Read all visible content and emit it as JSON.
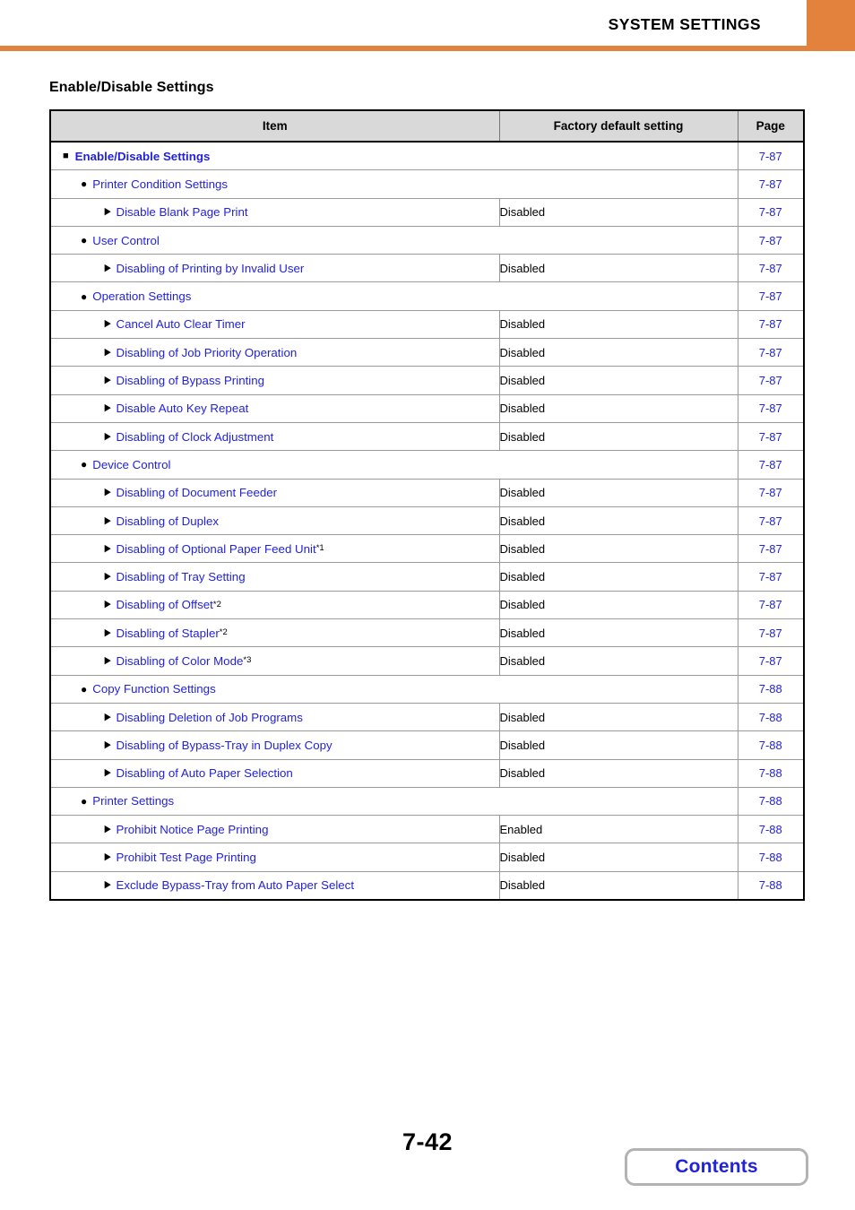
{
  "header": {
    "title": "SYSTEM SETTINGS",
    "accent_color": "#e2823c"
  },
  "section": {
    "title": "Enable/Disable Settings"
  },
  "table": {
    "columns": [
      "Item",
      "Factory default setting",
      "Page"
    ],
    "rows": [
      {
        "level": 1,
        "bullet": "square-bullet-icon",
        "label": "Enable/Disable Settings",
        "footnote": "",
        "factory": null,
        "page": "7-87"
      },
      {
        "level": 2,
        "bullet": "circle-bullet-icon",
        "label": "Printer Condition Settings",
        "footnote": "",
        "factory": null,
        "page": "7-87"
      },
      {
        "level": 3,
        "bullet": "triangle-bullet-icon",
        "label": "Disable Blank Page Print",
        "footnote": "",
        "factory": "Disabled",
        "page": "7-87"
      },
      {
        "level": 2,
        "bullet": "circle-bullet-icon",
        "label": "User Control",
        "footnote": "",
        "factory": null,
        "page": "7-87"
      },
      {
        "level": 3,
        "bullet": "triangle-bullet-icon",
        "label": "Disabling of Printing by Invalid User",
        "footnote": "",
        "factory": "Disabled",
        "page": "7-87"
      },
      {
        "level": 2,
        "bullet": "circle-bullet-icon",
        "label": "Operation Settings",
        "footnote": "",
        "factory": null,
        "page": "7-87"
      },
      {
        "level": 3,
        "bullet": "triangle-bullet-icon",
        "label": "Cancel Auto Clear Timer",
        "footnote": "",
        "factory": "Disabled",
        "page": "7-87"
      },
      {
        "level": 3,
        "bullet": "triangle-bullet-icon",
        "label": "Disabling of Job Priority Operation",
        "footnote": "",
        "factory": "Disabled",
        "page": "7-87"
      },
      {
        "level": 3,
        "bullet": "triangle-bullet-icon",
        "label": "Disabling of Bypass Printing",
        "footnote": "",
        "factory": "Disabled",
        "page": "7-87"
      },
      {
        "level": 3,
        "bullet": "triangle-bullet-icon",
        "label": "Disable Auto Key Repeat",
        "footnote": "",
        "factory": "Disabled",
        "page": "7-87"
      },
      {
        "level": 3,
        "bullet": "triangle-bullet-icon",
        "label": "Disabling of Clock Adjustment",
        "footnote": "",
        "factory": "Disabled",
        "page": "7-87"
      },
      {
        "level": 2,
        "bullet": "circle-bullet-icon",
        "label": "Device Control",
        "footnote": "",
        "factory": null,
        "page": "7-87"
      },
      {
        "level": 3,
        "bullet": "triangle-bullet-icon",
        "label": "Disabling of Document Feeder",
        "footnote": "",
        "factory": "Disabled",
        "page": "7-87"
      },
      {
        "level": 3,
        "bullet": "triangle-bullet-icon",
        "label": "Disabling of Duplex",
        "footnote": "",
        "factory": "Disabled",
        "page": "7-87"
      },
      {
        "level": 3,
        "bullet": "triangle-bullet-icon",
        "label": "Disabling of Optional Paper Feed Unit",
        "footnote": "*1",
        "factory": "Disabled",
        "page": "7-87"
      },
      {
        "level": 3,
        "bullet": "triangle-bullet-icon",
        "label": "Disabling of Tray Setting",
        "footnote": "",
        "factory": "Disabled",
        "page": "7-87"
      },
      {
        "level": 3,
        "bullet": "triangle-bullet-icon",
        "label": "Disabling of Offset",
        "footnote": "*2",
        "factory": "Disabled",
        "page": "7-87"
      },
      {
        "level": 3,
        "bullet": "triangle-bullet-icon",
        "label": "Disabling of Stapler",
        "footnote": "*2",
        "factory": "Disabled",
        "page": "7-87"
      },
      {
        "level": 3,
        "bullet": "triangle-bullet-icon",
        "label": "Disabling of Color Mode",
        "footnote": "*3",
        "factory": "Disabled",
        "page": "7-87"
      },
      {
        "level": 2,
        "bullet": "circle-bullet-icon",
        "label": "Copy Function Settings",
        "footnote": "",
        "factory": null,
        "page": "7-88"
      },
      {
        "level": 3,
        "bullet": "triangle-bullet-icon",
        "label": "Disabling Deletion of Job Programs",
        "footnote": "",
        "factory": "Disabled",
        "page": "7-88"
      },
      {
        "level": 3,
        "bullet": "triangle-bullet-icon",
        "label": "Disabling of Bypass-Tray in Duplex Copy",
        "footnote": "",
        "factory": "Disabled",
        "page": "7-88"
      },
      {
        "level": 3,
        "bullet": "triangle-bullet-icon",
        "label": "Disabling of Auto Paper Selection",
        "footnote": "",
        "factory": "Disabled",
        "page": "7-88"
      },
      {
        "level": 2,
        "bullet": "circle-bullet-icon",
        "label": "Printer Settings",
        "footnote": "",
        "factory": null,
        "page": "7-88"
      },
      {
        "level": 3,
        "bullet": "triangle-bullet-icon",
        "label": "Prohibit Notice Page Printing",
        "footnote": "",
        "factory": "Enabled",
        "page": "7-88"
      },
      {
        "level": 3,
        "bullet": "triangle-bullet-icon",
        "label": "Prohibit Test Page Printing",
        "footnote": "",
        "factory": "Disabled",
        "page": "7-88"
      },
      {
        "level": 3,
        "bullet": "triangle-bullet-icon",
        "label": "Exclude Bypass-Tray from Auto Paper Select",
        "footnote": "",
        "factory": "Disabled",
        "page": "7-88"
      }
    ]
  },
  "footer": {
    "page_number": "7-42",
    "contents_label": "Contents"
  },
  "colors": {
    "link": "#2222dd",
    "accent": "#e2823c",
    "table_header_bg": "#d9d9d9"
  }
}
